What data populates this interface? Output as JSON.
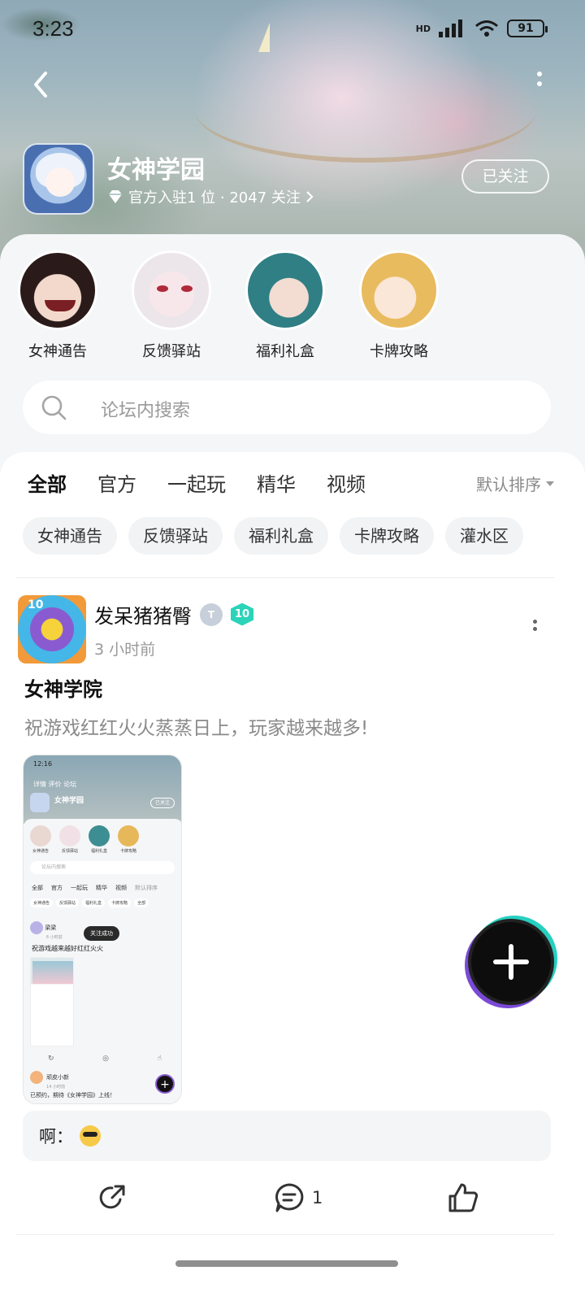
{
  "status_bar": {
    "time": "3:23",
    "network": "HD",
    "battery": "91"
  },
  "header": {
    "forum_name": "女神学园",
    "meta": "官方入驻1 位 · 2047 关注",
    "follow_label": "已关注"
  },
  "categories": [
    {
      "label": "女神通告",
      "color": "#e9d7d2"
    },
    {
      "label": "反馈驿站",
      "color": "#f1e1e6"
    },
    {
      "label": "福利礼盒",
      "color": "#3d8e92"
    },
    {
      "label": "卡牌攻略",
      "color": "#e7b85a"
    }
  ],
  "search": {
    "placeholder": "论坛内搜索"
  },
  "tabs": [
    {
      "label": "全部",
      "active": true
    },
    {
      "label": "官方",
      "active": false
    },
    {
      "label": "一起玩",
      "active": false
    },
    {
      "label": "精华",
      "active": false
    },
    {
      "label": "视频",
      "active": false
    }
  ],
  "sort_label": "默认排序",
  "chips": [
    "女神通告",
    "反馈驿站",
    "福利礼盒",
    "卡牌攻略",
    "灌水区"
  ],
  "post": {
    "author": "发呆猪猪臀",
    "level": "10",
    "time": "3 小时前",
    "title": "女神学院",
    "body": "祝游戏红红火火蒸蒸日上，玩家越来越多!",
    "screenshot": {
      "time": "12:16",
      "nav": "详情   评价   论坛",
      "title": "女神学园",
      "follow": "已关注",
      "circles": [
        "女神通告",
        "反馈驿站",
        "福利礼盒",
        "卡牌攻略"
      ],
      "search": "论坛内搜索",
      "tabs": [
        "全部",
        "官方",
        "一起玩",
        "精华",
        "视频",
        "默认排序"
      ],
      "chips": [
        "女神通告",
        "反馈驿站",
        "福利礼盒",
        "卡牌攻略",
        "全部"
      ],
      "toast": "关注成功",
      "post_author": "梁梁",
      "post_time": "6 小时前",
      "post_line": "祝游戏越来越好红红火火",
      "comment_author": "顽皮小新",
      "comment_time": "14 小时前",
      "comment_text": "已预约，期待《女神学园》上线！"
    },
    "comment_prefix": "啊："
  },
  "actions": {
    "share": "",
    "comments": "1",
    "likes": ""
  }
}
